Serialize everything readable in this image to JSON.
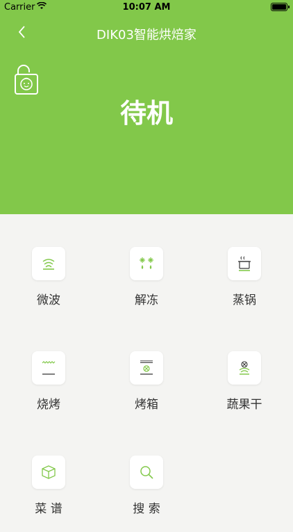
{
  "status_bar": {
    "carrier": "Carrier",
    "time": "10:07 AM"
  },
  "header": {
    "title": "DIK03智能烘焙家",
    "state": "待机"
  },
  "colors": {
    "accent": "#82c84a",
    "background": "#f4f4f2"
  },
  "modes": [
    {
      "label": "微波",
      "icon": "microwave-icon"
    },
    {
      "label": "解冻",
      "icon": "defrost-icon"
    },
    {
      "label": "蒸锅",
      "icon": "steam-pot-icon"
    },
    {
      "label": "烧烤",
      "icon": "grill-icon"
    },
    {
      "label": "烤箱",
      "icon": "oven-fan-icon"
    },
    {
      "label": "蔬果干",
      "icon": "dehydrate-icon"
    },
    {
      "label": "菜 谱",
      "icon": "recipe-box-icon"
    },
    {
      "label": "搜 索",
      "icon": "search-icon"
    }
  ]
}
